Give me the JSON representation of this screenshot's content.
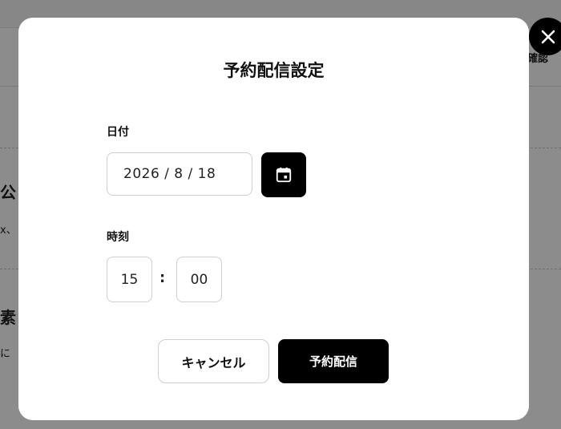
{
  "background": {
    "header_link": "確認",
    "heading_1": "公",
    "text_1": "x、",
    "heading_2": "素",
    "text_2": "に"
  },
  "modal": {
    "title": "予約配信設定",
    "close_icon": "close-icon",
    "date": {
      "label": "日付",
      "value": "2026 / 8 / 18",
      "calendar_icon": "calendar-icon"
    },
    "time": {
      "label": "時刻",
      "hour": "15",
      "separator": ":",
      "minute": "00"
    },
    "buttons": {
      "cancel": "キャンセル",
      "submit": "予約配信"
    }
  },
  "colors": {
    "overlay": "#8c8c8c",
    "modal_bg": "#ffffff",
    "primary": "#000000",
    "border": "#cfcfcf"
  }
}
